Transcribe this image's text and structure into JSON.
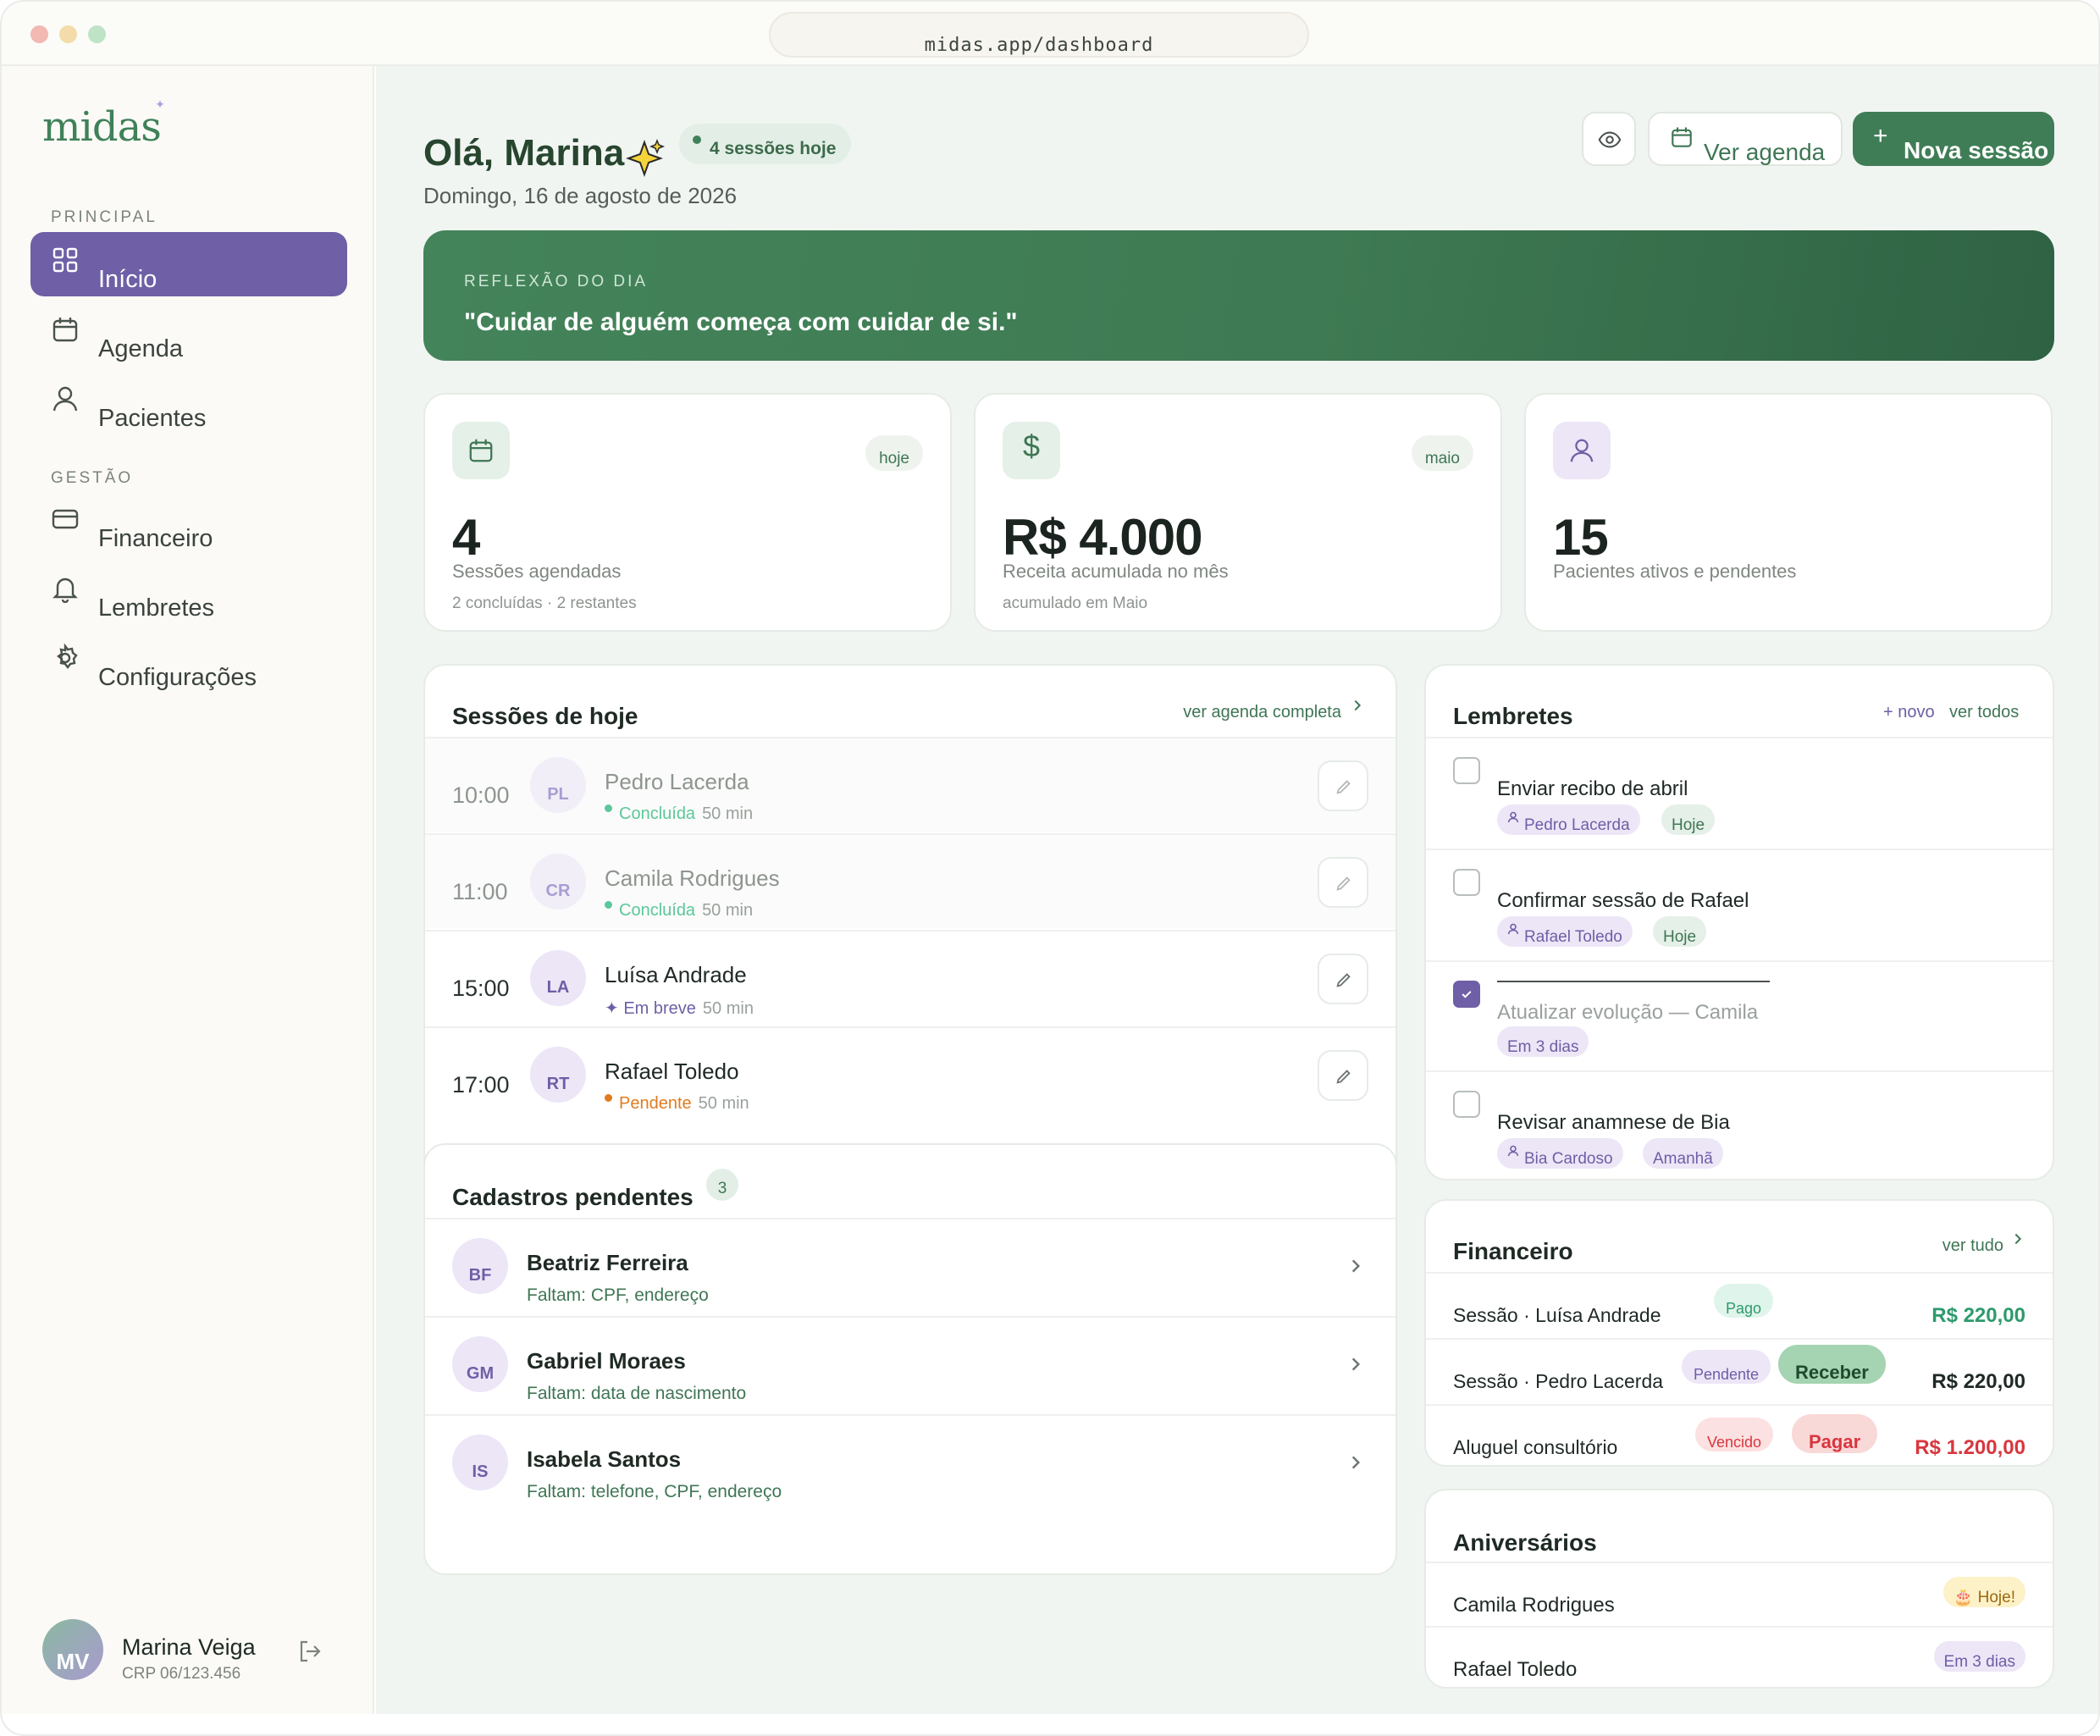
{
  "browser": {
    "url": "midas.app/dashboard"
  },
  "brand": {
    "logo": "midas",
    "accent": "#3f7d56",
    "purple": "#6e5fa6"
  },
  "sidebar": {
    "section_principal": "PRINCIPAL",
    "section_gestao": "GESTÃO",
    "items": [
      {
        "label": "Início",
        "icon": "grid-icon"
      },
      {
        "label": "Agenda",
        "icon": "calendar-icon"
      },
      {
        "label": "Pacientes",
        "icon": "user-icon"
      },
      {
        "label": "Financeiro",
        "icon": "card-icon"
      },
      {
        "label": "Lembretes",
        "icon": "bell-icon"
      },
      {
        "label": "Configurações",
        "icon": "gear-icon"
      }
    ],
    "user": {
      "initials": "MV",
      "name": "Marina Veiga",
      "crp": "CRP 06/123.456"
    }
  },
  "header": {
    "greeting": "Olá, Marina",
    "sessions_pill": "4 sessões hoje",
    "date": "Domingo, 16 de agosto de 2026",
    "btn_agenda": "Ver agenda",
    "btn_new": "Nova sessão"
  },
  "banner": {
    "label": "REFLEXÃO DO DIA",
    "quote": "\"Cuidar de alguém começa com cuidar de si.\""
  },
  "stats": [
    {
      "tag": "hoje",
      "value": "4",
      "label": "Sessões agendadas",
      "sub": "2 concluídas · 2 restantes",
      "icon": "calendar-icon"
    },
    {
      "tag": "maio",
      "value": "R$ 4.000",
      "label": "Receita acumulada no mês",
      "sub": "acumulado em Maio",
      "icon": "dollar-icon"
    },
    {
      "value": "15",
      "label": "Pacientes ativos e pendentes",
      "icon": "user-icon"
    }
  ],
  "sessions": {
    "title": "Sessões de hoje",
    "link": "ver agenda completa",
    "rows": [
      {
        "time": "10:00",
        "initials": "PL",
        "name": "Pedro Lacerda",
        "status": "Concluída",
        "duration": "50 min"
      },
      {
        "time": "11:00",
        "initials": "CR",
        "name": "Camila Rodrigues",
        "status": "Concluída",
        "duration": "50 min"
      },
      {
        "time": "15:00",
        "initials": "LA",
        "name": "Luísa Andrade",
        "status": "✦ Em breve",
        "duration": "50 min"
      },
      {
        "time": "17:00",
        "initials": "RT",
        "name": "Rafael Toledo",
        "status": "Pendente",
        "duration": "50 min"
      }
    ]
  },
  "pending": {
    "title": "Cadastros pendentes",
    "count": "3",
    "rows": [
      {
        "initials": "BF",
        "name": "Beatriz Ferreira",
        "missing": "Faltam: CPF, endereço"
      },
      {
        "initials": "GM",
        "name": "Gabriel Moraes",
        "missing": "Faltam: data de nascimento"
      },
      {
        "initials": "IS",
        "name": "Isabela Santos",
        "missing": "Faltam: telefone, CPF, endereço"
      }
    ]
  },
  "reminders": {
    "title": "Lembretes",
    "new_link": "+ novo",
    "all_link": "ver todos",
    "rows": [
      {
        "text": "Enviar recibo de abril",
        "patient": "Pedro Lacerda",
        "when": "Hoje",
        "done": false
      },
      {
        "text": "Confirmar sessão de Rafael",
        "patient": "Rafael Toledo",
        "when": "Hoje",
        "done": false
      },
      {
        "text": "Atualizar evolução — Camila",
        "when": "Em 3 dias",
        "done": true
      },
      {
        "text": "Revisar anamnese de Bia",
        "patient": "Bia Cardoso",
        "when": "Amanhã",
        "done": false
      }
    ]
  },
  "finance": {
    "title": "Financeiro",
    "link": "ver tudo",
    "rows": [
      {
        "desc": "Sessão · Luísa Andrade",
        "badge": "Pago",
        "amount": "R$ 220,00"
      },
      {
        "desc": "Sessão · Pedro Lacerda",
        "badge": "Pendente",
        "action": "Receber",
        "amount": "R$ 220,00"
      },
      {
        "desc": "Aluguel consultório",
        "badge": "Vencido",
        "action": "Pagar",
        "amount": "R$ 1.200,00"
      }
    ]
  },
  "birthdays": {
    "title": "Aniversários",
    "rows": [
      {
        "name": "Camila Rodrigues",
        "when": "🎂 Hoje!"
      },
      {
        "name": "Rafael Toledo",
        "when": "Em 3 dias"
      }
    ]
  }
}
